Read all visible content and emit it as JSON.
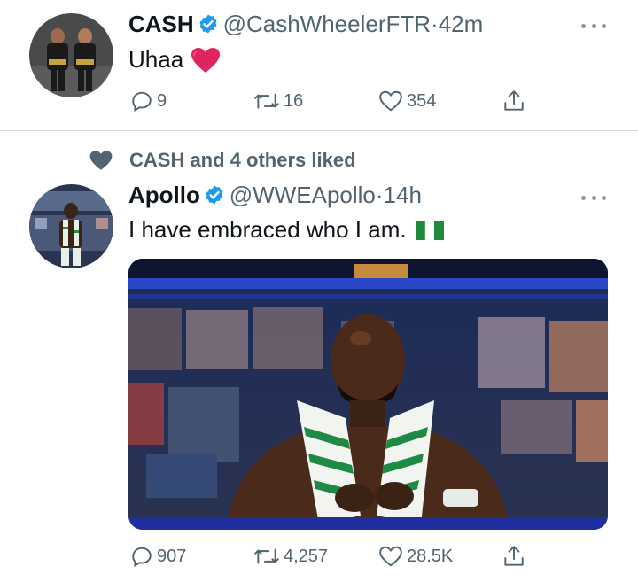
{
  "tweet1": {
    "name": "CASH",
    "handle": "@CashWheelerFTR",
    "sep": "·",
    "time": "42m",
    "text": "Uhaa",
    "emoji": "❤️",
    "replies": "9",
    "retweets": "16",
    "likes": "354"
  },
  "social_context": {
    "text": "CASH and 4 others liked"
  },
  "tweet2": {
    "name": "Apollo",
    "handle": "@WWEApollo",
    "sep": "·",
    "time": "14h",
    "text": "I have embraced who I am.",
    "flag": "Nigeria flag",
    "replies": "907",
    "retweets": "4,257",
    "likes": "28.5K"
  },
  "colors": {
    "verified": "#1d9bf0",
    "heart": "#e0245e",
    "icon_gray": "#536471"
  }
}
